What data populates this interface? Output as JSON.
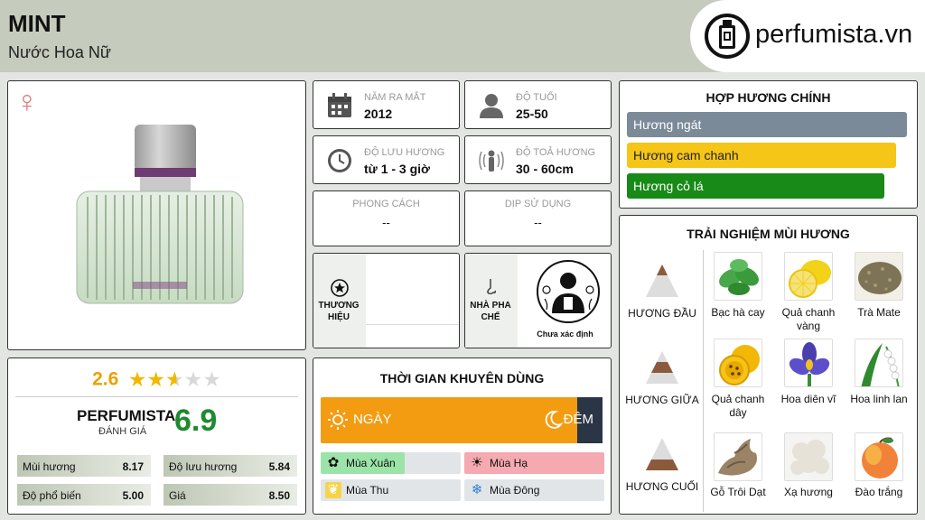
{
  "header": {
    "title": "MINT",
    "subtitle": "Nước Hoa Nữ",
    "logo_text": "perfumista.vn"
  },
  "product": {
    "gender_icon": "female-symbol",
    "image": "perfume-bottle"
  },
  "info": {
    "release": {
      "label": "NĂM RA MẮT",
      "value": "2012",
      "icon": "calendar-icon"
    },
    "age": {
      "label": "ĐỘ TUỔI",
      "value": "25-50",
      "icon": "person-icon"
    },
    "longevity": {
      "label": "ĐỘ LƯU HƯƠNG",
      "value": "từ 1 - 3 giờ",
      "icon": "clock-icon"
    },
    "sillage": {
      "label": "ĐỘ TOẢ HƯƠNG",
      "value": "30 - 60cm",
      "icon": "radiating-person-icon"
    },
    "style": {
      "label": "PHONG CÁCH",
      "value": "--"
    },
    "occasion": {
      "label": "DỊP SỬ DỤNG",
      "value": "--"
    },
    "brand": {
      "label_line1": "THƯƠNG",
      "label_line2": "HIỆU",
      "icon": "star-badge-icon"
    },
    "perfumer": {
      "label_line1": "NHÀ PHA",
      "label_line2": "CHẾ",
      "icon": "nose-icon",
      "name": "Chưa xác định"
    }
  },
  "rating": {
    "user_score": "2.6",
    "stars_filled": 2.6,
    "stars_total": 5,
    "brand": "PERFUMISTA",
    "eval_label": "ĐÁNH GIÁ",
    "score": "6.9",
    "metrics": [
      {
        "label": "Mùi hương",
        "value": "8.17"
      },
      {
        "label": "Độ lưu hương",
        "value": "5.84"
      },
      {
        "label": "Độ phổ biến",
        "value": "5.00"
      },
      {
        "label": "Giá",
        "value": "8.50"
      }
    ]
  },
  "usage": {
    "title": "THỜI GIAN KHUYÊN DÙNG",
    "day": "NGÀY",
    "night": "ĐÊM",
    "day_fraction": 0.91,
    "seasons": [
      {
        "label": "Mùa Xuân",
        "icon": "spring-flower-icon",
        "level": 0.6,
        "color": "#9be3a8"
      },
      {
        "label": "Mùa Hạ",
        "icon": "sun-icon",
        "level": 1.0,
        "color": "#f5a9b0"
      },
      {
        "label": "Mùa Thu",
        "icon": "leaf-icon",
        "level": 0.0,
        "color": "#f6d44a"
      },
      {
        "label": "Mùa Đông",
        "icon": "snowflake-icon",
        "level": 0.0,
        "color": "#9ec7f0"
      }
    ]
  },
  "accords": {
    "title": "HỢP HƯƠNG CHÍNH",
    "items": [
      {
        "label": "Hương ngát",
        "level": 1.0,
        "color": "#7b8a98"
      },
      {
        "label": "Hương cam chanh",
        "level": 0.96,
        "color": "#f5c518"
      },
      {
        "label": "Hương cỏ lá",
        "level": 0.92,
        "color": "#178a17"
      }
    ]
  },
  "notes": {
    "title": "TRẢI NGHIỆM MÙI HƯƠNG",
    "tiers": [
      {
        "label": "HƯƠNG ĐẦU",
        "items": [
          {
            "label": "Bạc hà cay",
            "icon": "mint-leaves"
          },
          {
            "label": "Quả chanh vàng",
            "icon": "lemon"
          },
          {
            "label": "Trà Mate",
            "icon": "mate-tea"
          }
        ]
      },
      {
        "label": "HƯƠNG GIỮA",
        "items": [
          {
            "label": "Quả chanh dây",
            "icon": "passion-fruit"
          },
          {
            "label": "Hoa diên vĩ",
            "icon": "iris-flower"
          },
          {
            "label": "Hoa linh lan",
            "icon": "lily-of-the-valley"
          }
        ]
      },
      {
        "label": "HƯƠNG CUỐI",
        "items": [
          {
            "label": "Gỗ Trôi Dạt",
            "icon": "driftwood"
          },
          {
            "label": "Xạ hương",
            "icon": "musk-cotton"
          },
          {
            "label": "Đào trắng",
            "icon": "white-peach"
          }
        ]
      }
    ]
  }
}
